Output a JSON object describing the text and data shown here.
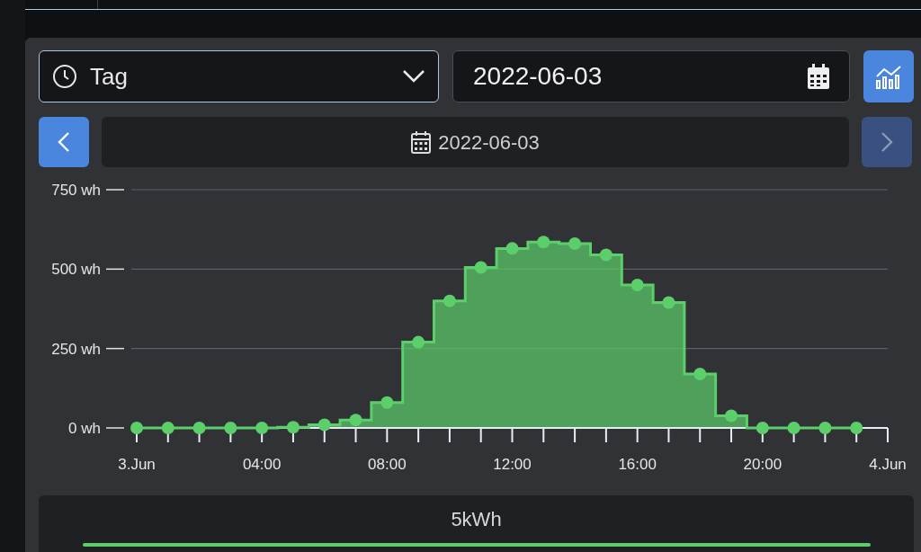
{
  "period_select": {
    "value": "Tag"
  },
  "date_field": {
    "value": "2022-06-03"
  },
  "navigation": {
    "date": "2022-06-03",
    "prev_disabled": false,
    "next_disabled": true
  },
  "chart_data": {
    "type": "area",
    "x": [
      0,
      1,
      2,
      3,
      4,
      5,
      6,
      7,
      8,
      9,
      10,
      11,
      12,
      13,
      14,
      15,
      16,
      17,
      18,
      19,
      20,
      21,
      22,
      23
    ],
    "series": [
      {
        "color": "#5ccf6a",
        "values": [
          0,
          0,
          0,
          0,
          0,
          2,
          10,
          25,
          80,
          270,
          400,
          505,
          565,
          585,
          580,
          545,
          450,
          395,
          170,
          38,
          0,
          0,
          0,
          0
        ]
      }
    ],
    "xlim": [
      0,
      24
    ],
    "ylim": [
      0,
      750
    ],
    "xticks": [
      {
        "value": 0,
        "label": "3.Jun"
      },
      {
        "value": 4,
        "label": "04:00"
      },
      {
        "value": 8,
        "label": "08:00"
      },
      {
        "value": 12,
        "label": "12:00"
      },
      {
        "value": 16,
        "label": "16:00"
      },
      {
        "value": 20,
        "label": "20:00"
      },
      {
        "value": 24,
        "label": "4.Jun"
      }
    ],
    "yticks": [
      {
        "value": 0,
        "label": "0 wh"
      },
      {
        "value": 250,
        "label": "250 wh"
      },
      {
        "value": 500,
        "label": "500 wh"
      },
      {
        "value": 750,
        "label": "750 wh"
      }
    ]
  },
  "total": {
    "label": "5kWh",
    "level": 1
  }
}
